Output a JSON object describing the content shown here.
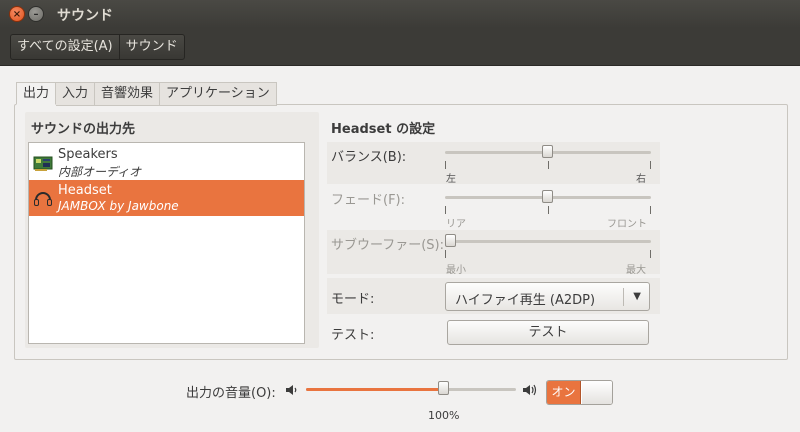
{
  "window": {
    "title": "サウンド",
    "close_glyph": "×",
    "min_glyph": "–"
  },
  "toolbar": {
    "all_settings": "すべての設定(A)",
    "current": "サウンド"
  },
  "tabs": [
    {
      "label": "出力",
      "active": true
    },
    {
      "label": "入力",
      "active": false
    },
    {
      "label": "音響効果",
      "active": false
    },
    {
      "label": "アプリケーション",
      "active": false
    }
  ],
  "output": {
    "heading": "サウンドの出力先",
    "devices": [
      {
        "name": "Speakers",
        "detail": "内部オーディオ",
        "icon": "speaker-card-icon",
        "selected": false
      },
      {
        "name": "Headset",
        "detail": "JAMBOX by Jawbone",
        "icon": "headset-icon",
        "selected": true
      }
    ]
  },
  "settings": {
    "heading": "Headset の設定",
    "balance": {
      "label": "バランス(B):",
      "left": "左",
      "right": "右",
      "value": 0.5
    },
    "fade": {
      "label": "フェード(F):",
      "left": "リア",
      "right": "フロント",
      "value": 0.5,
      "enabled": false
    },
    "subwoofer": {
      "label": "サブウーファー(S):",
      "left": "最小",
      "right": "最大",
      "value": 0.0,
      "enabled": false
    },
    "mode": {
      "label": "モード:",
      "value": "ハイファイ再生 (A2DP)"
    },
    "test": {
      "label": "テスト:",
      "button": "テスト"
    }
  },
  "volume": {
    "label": "出力の音量(O):",
    "value_text": "100%",
    "value": 0.65,
    "switch_on": "オン",
    "accent": "#e9743f"
  }
}
